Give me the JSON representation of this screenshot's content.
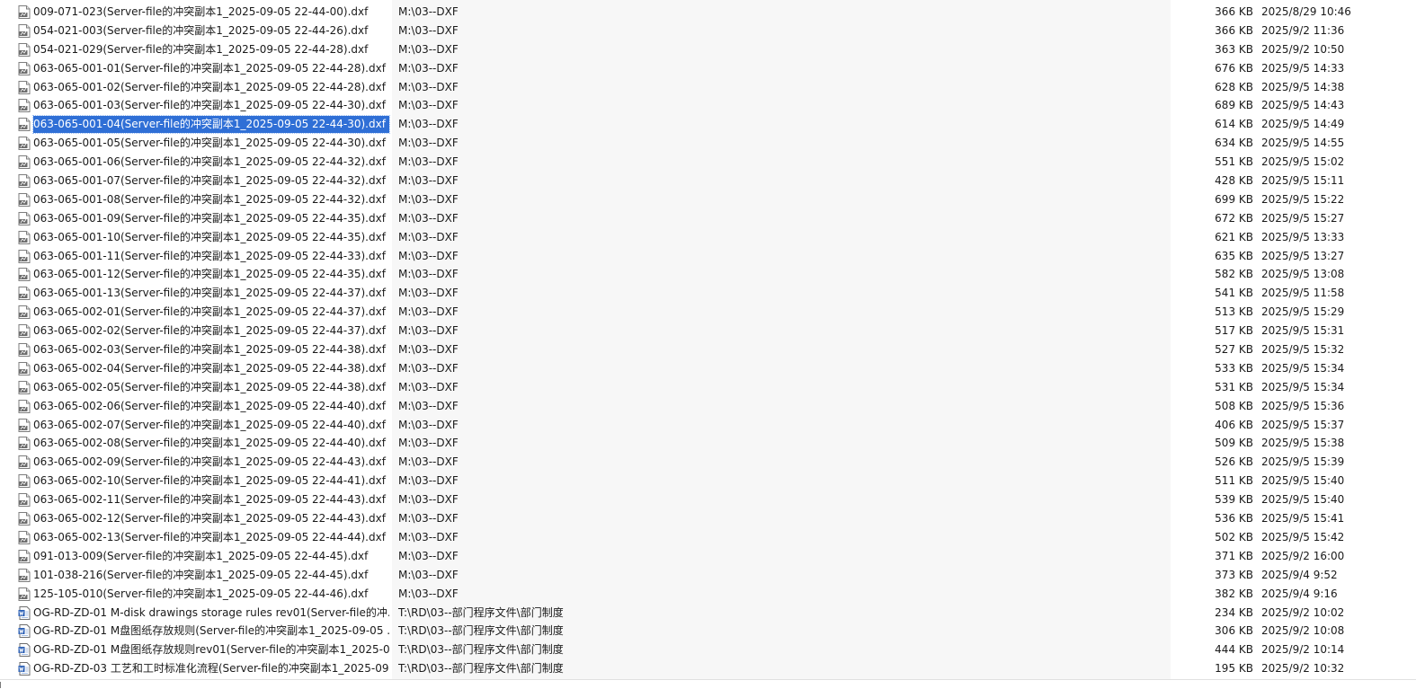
{
  "files": [
    {
      "name": "009-071-023(Server-file的冲突副本1_2025-09-05 22-44-00).dxf",
      "path": "M:\\03--DXF",
      "size": "366 KB",
      "date": "2025/8/29 10:46",
      "icon": "dxf-file-icon"
    },
    {
      "name": "054-021-003(Server-file的冲突副本1_2025-09-05 22-44-26).dxf",
      "path": "M:\\03--DXF",
      "size": "366 KB",
      "date": "2025/9/2 11:36",
      "icon": "dxf-file-icon"
    },
    {
      "name": "054-021-029(Server-file的冲突副本1_2025-09-05 22-44-28).dxf",
      "path": "M:\\03--DXF",
      "size": "363 KB",
      "date": "2025/9/2 10:50",
      "icon": "dxf-file-icon"
    },
    {
      "name": "063-065-001-01(Server-file的冲突副本1_2025-09-05 22-44-28).dxf",
      "path": "M:\\03--DXF",
      "size": "676 KB",
      "date": "2025/9/5 14:33",
      "icon": "dxf-file-icon"
    },
    {
      "name": "063-065-001-02(Server-file的冲突副本1_2025-09-05 22-44-28).dxf",
      "path": "M:\\03--DXF",
      "size": "628 KB",
      "date": "2025/9/5 14:38",
      "icon": "dxf-file-icon"
    },
    {
      "name": "063-065-001-03(Server-file的冲突副本1_2025-09-05 22-44-30).dxf",
      "path": "M:\\03--DXF",
      "size": "689 KB",
      "date": "2025/9/5 14:43",
      "icon": "dxf-file-icon"
    },
    {
      "name": "063-065-001-04(Server-file的冲突副本1_2025-09-05 22-44-30).dxf",
      "path": "M:\\03--DXF",
      "size": "614 KB",
      "date": "2025/9/5 14:49",
      "icon": "dxf-file-icon",
      "selected": true
    },
    {
      "name": "063-065-001-05(Server-file的冲突副本1_2025-09-05 22-44-30).dxf",
      "path": "M:\\03--DXF",
      "size": "634 KB",
      "date": "2025/9/5 14:55",
      "icon": "dxf-file-icon"
    },
    {
      "name": "063-065-001-06(Server-file的冲突副本1_2025-09-05 22-44-32).dxf",
      "path": "M:\\03--DXF",
      "size": "551 KB",
      "date": "2025/9/5 15:02",
      "icon": "dxf-file-icon"
    },
    {
      "name": "063-065-001-07(Server-file的冲突副本1_2025-09-05 22-44-32).dxf",
      "path": "M:\\03--DXF",
      "size": "428 KB",
      "date": "2025/9/5 15:11",
      "icon": "dxf-file-icon"
    },
    {
      "name": "063-065-001-08(Server-file的冲突副本1_2025-09-05 22-44-32).dxf",
      "path": "M:\\03--DXF",
      "size": "699 KB",
      "date": "2025/9/5 15:22",
      "icon": "dxf-file-icon"
    },
    {
      "name": "063-065-001-09(Server-file的冲突副本1_2025-09-05 22-44-35).dxf",
      "path": "M:\\03--DXF",
      "size": "672 KB",
      "date": "2025/9/5 15:27",
      "icon": "dxf-file-icon"
    },
    {
      "name": "063-065-001-10(Server-file的冲突副本1_2025-09-05 22-44-35).dxf",
      "path": "M:\\03--DXF",
      "size": "621 KB",
      "date": "2025/9/5 13:33",
      "icon": "dxf-file-icon"
    },
    {
      "name": "063-065-001-11(Server-file的冲突副本1_2025-09-05 22-44-33).dxf",
      "path": "M:\\03--DXF",
      "size": "635 KB",
      "date": "2025/9/5 13:27",
      "icon": "dxf-file-icon"
    },
    {
      "name": "063-065-001-12(Server-file的冲突副本1_2025-09-05 22-44-35).dxf",
      "path": "M:\\03--DXF",
      "size": "582 KB",
      "date": "2025/9/5 13:08",
      "icon": "dxf-file-icon"
    },
    {
      "name": "063-065-001-13(Server-file的冲突副本1_2025-09-05 22-44-37).dxf",
      "path": "M:\\03--DXF",
      "size": "541 KB",
      "date": "2025/9/5 11:58",
      "icon": "dxf-file-icon"
    },
    {
      "name": "063-065-002-01(Server-file的冲突副本1_2025-09-05 22-44-37).dxf",
      "path": "M:\\03--DXF",
      "size": "513 KB",
      "date": "2025/9/5 15:29",
      "icon": "dxf-file-icon"
    },
    {
      "name": "063-065-002-02(Server-file的冲突副本1_2025-09-05 22-44-37).dxf",
      "path": "M:\\03--DXF",
      "size": "517 KB",
      "date": "2025/9/5 15:31",
      "icon": "dxf-file-icon"
    },
    {
      "name": "063-065-002-03(Server-file的冲突副本1_2025-09-05 22-44-38).dxf",
      "path": "M:\\03--DXF",
      "size": "527 KB",
      "date": "2025/9/5 15:32",
      "icon": "dxf-file-icon"
    },
    {
      "name": "063-065-002-04(Server-file的冲突副本1_2025-09-05 22-44-38).dxf",
      "path": "M:\\03--DXF",
      "size": "533 KB",
      "date": "2025/9/5 15:34",
      "icon": "dxf-file-icon"
    },
    {
      "name": "063-065-002-05(Server-file的冲突副本1_2025-09-05 22-44-38).dxf",
      "path": "M:\\03--DXF",
      "size": "531 KB",
      "date": "2025/9/5 15:34",
      "icon": "dxf-file-icon"
    },
    {
      "name": "063-065-002-06(Server-file的冲突副本1_2025-09-05 22-44-40).dxf",
      "path": "M:\\03--DXF",
      "size": "508 KB",
      "date": "2025/9/5 15:36",
      "icon": "dxf-file-icon"
    },
    {
      "name": "063-065-002-07(Server-file的冲突副本1_2025-09-05 22-44-40).dxf",
      "path": "M:\\03--DXF",
      "size": "406 KB",
      "date": "2025/9/5 15:37",
      "icon": "dxf-file-icon"
    },
    {
      "name": "063-065-002-08(Server-file的冲突副本1_2025-09-05 22-44-40).dxf",
      "path": "M:\\03--DXF",
      "size": "509 KB",
      "date": "2025/9/5 15:38",
      "icon": "dxf-file-icon"
    },
    {
      "name": "063-065-002-09(Server-file的冲突副本1_2025-09-05 22-44-43).dxf",
      "path": "M:\\03--DXF",
      "size": "526 KB",
      "date": "2025/9/5 15:39",
      "icon": "dxf-file-icon"
    },
    {
      "name": "063-065-002-10(Server-file的冲突副本1_2025-09-05 22-44-41).dxf",
      "path": "M:\\03--DXF",
      "size": "511 KB",
      "date": "2025/9/5 15:40",
      "icon": "dxf-file-icon"
    },
    {
      "name": "063-065-002-11(Server-file的冲突副本1_2025-09-05 22-44-43).dxf",
      "path": "M:\\03--DXF",
      "size": "539 KB",
      "date": "2025/9/5 15:40",
      "icon": "dxf-file-icon"
    },
    {
      "name": "063-065-002-12(Server-file的冲突副本1_2025-09-05 22-44-43).dxf",
      "path": "M:\\03--DXF",
      "size": "536 KB",
      "date": "2025/9/5 15:41",
      "icon": "dxf-file-icon"
    },
    {
      "name": "063-065-002-13(Server-file的冲突副本1_2025-09-05 22-44-44).dxf",
      "path": "M:\\03--DXF",
      "size": "502 KB",
      "date": "2025/9/5 15:42",
      "icon": "dxf-file-icon"
    },
    {
      "name": "091-013-009(Server-file的冲突副本1_2025-09-05 22-44-45).dxf",
      "path": "M:\\03--DXF",
      "size": "371 KB",
      "date": "2025/9/2 16:00",
      "icon": "dxf-file-icon"
    },
    {
      "name": "101-038-216(Server-file的冲突副本1_2025-09-05 22-44-45).dxf",
      "path": "M:\\03--DXF",
      "size": "373 KB",
      "date": "2025/9/4 9:52",
      "icon": "dxf-file-icon"
    },
    {
      "name": "125-105-010(Server-file的冲突副本1_2025-09-05 22-44-46).dxf",
      "path": "M:\\03--DXF",
      "size": "382 KB",
      "date": "2025/9/4 9:16",
      "icon": "dxf-file-icon"
    },
    {
      "name": "OG-RD-ZD-01 M-disk drawings storage rules rev01(Server-file的冲...",
      "path": "T:\\RD\\03--部门程序文件\\部门制度",
      "size": "234 KB",
      "date": "2025/9/2 10:02",
      "icon": "word-doc-icon"
    },
    {
      "name": "OG-RD-ZD-01 M盘图纸存放规则(Server-file的冲突副本1_2025-09-05 ...",
      "path": "T:\\RD\\03--部门程序文件\\部门制度",
      "size": "306 KB",
      "date": "2025/9/2 10:08",
      "icon": "word-doc-icon"
    },
    {
      "name": "OG-RD-ZD-01 M盘图纸存放规则rev01(Server-file的冲突副本1_2025-0...",
      "path": "T:\\RD\\03--部门程序文件\\部门制度",
      "size": "444 KB",
      "date": "2025/9/2 10:14",
      "icon": "word-doc-icon"
    },
    {
      "name": "OG-RD-ZD-03 工艺和工时标准化流程(Server-file的冲突副本1_2025-09...",
      "path": "T:\\RD\\03--部门程序文件\\部门制度",
      "size": "195 KB",
      "date": "2025/9/2 10:32",
      "icon": "word-doc-icon"
    }
  ],
  "colors": {
    "selection": "#2f6fd6",
    "path_band": "#f7f7f7",
    "text": "#1a1a1a"
  }
}
